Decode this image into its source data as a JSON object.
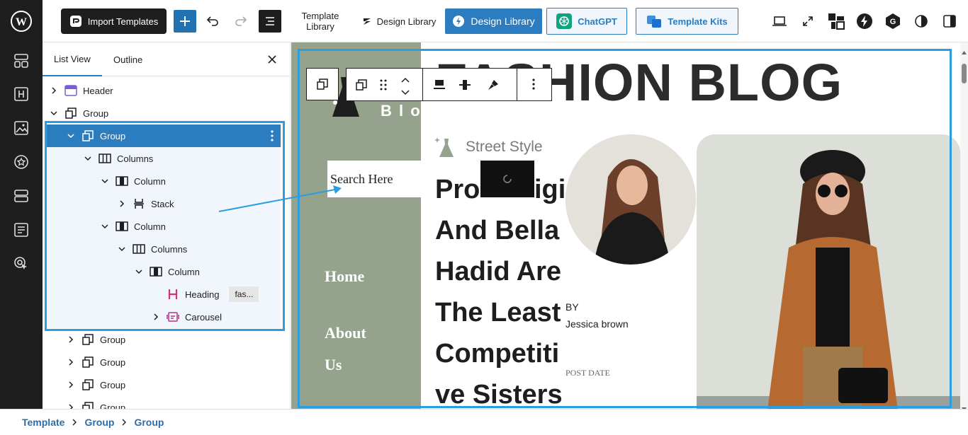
{
  "topbar": {
    "import_templates": "Import Templates",
    "template_library": [
      "Template",
      "Library"
    ],
    "design_library_text": "Design Library",
    "design_library_button": "Design Library",
    "chatgpt": "ChatGPT",
    "template_kits": "Template Kits"
  },
  "panel": {
    "tabs": [
      "List View",
      "Outline"
    ],
    "rows": [
      {
        "label": "Header",
        "badge": ""
      },
      {
        "label": "Group",
        "badge": ""
      },
      {
        "label": "Group",
        "badge": ""
      },
      {
        "label": "Columns",
        "badge": ""
      },
      {
        "label": "Column",
        "badge": ""
      },
      {
        "label": "Stack",
        "badge": ""
      },
      {
        "label": "Column",
        "badge": ""
      },
      {
        "label": "Columns",
        "badge": ""
      },
      {
        "label": "Column",
        "badge": ""
      },
      {
        "label": "Heading",
        "badge": "fas..."
      },
      {
        "label": "Carousel",
        "badge": ""
      },
      {
        "label": "Group",
        "badge": ""
      },
      {
        "label": "Group",
        "badge": ""
      },
      {
        "label": "Group",
        "badge": ""
      },
      {
        "label": "Group",
        "badge": ""
      }
    ]
  },
  "canvas": {
    "title": "FASHION BLOG",
    "logo_text": "B l o",
    "search_placeholder": "Search Here",
    "nav": [
      "Home",
      "About",
      "Us"
    ],
    "category": "Street Style",
    "headline_lines": [
      "Pro",
      "igi",
      "And Bella",
      "Hadid Are",
      "The Least",
      "Competiti",
      "ve Sisters"
    ],
    "by_label": "BY",
    "author": "Jessica brown",
    "post_date": "POST DATE"
  },
  "breadcrumbs": [
    "Template",
    "Group",
    "Group"
  ],
  "colors": {
    "accent": "#2b7dc0",
    "sidebar": "#1e1e1e",
    "green_panel": "#96a38c",
    "highlight": "#2b9de0"
  }
}
